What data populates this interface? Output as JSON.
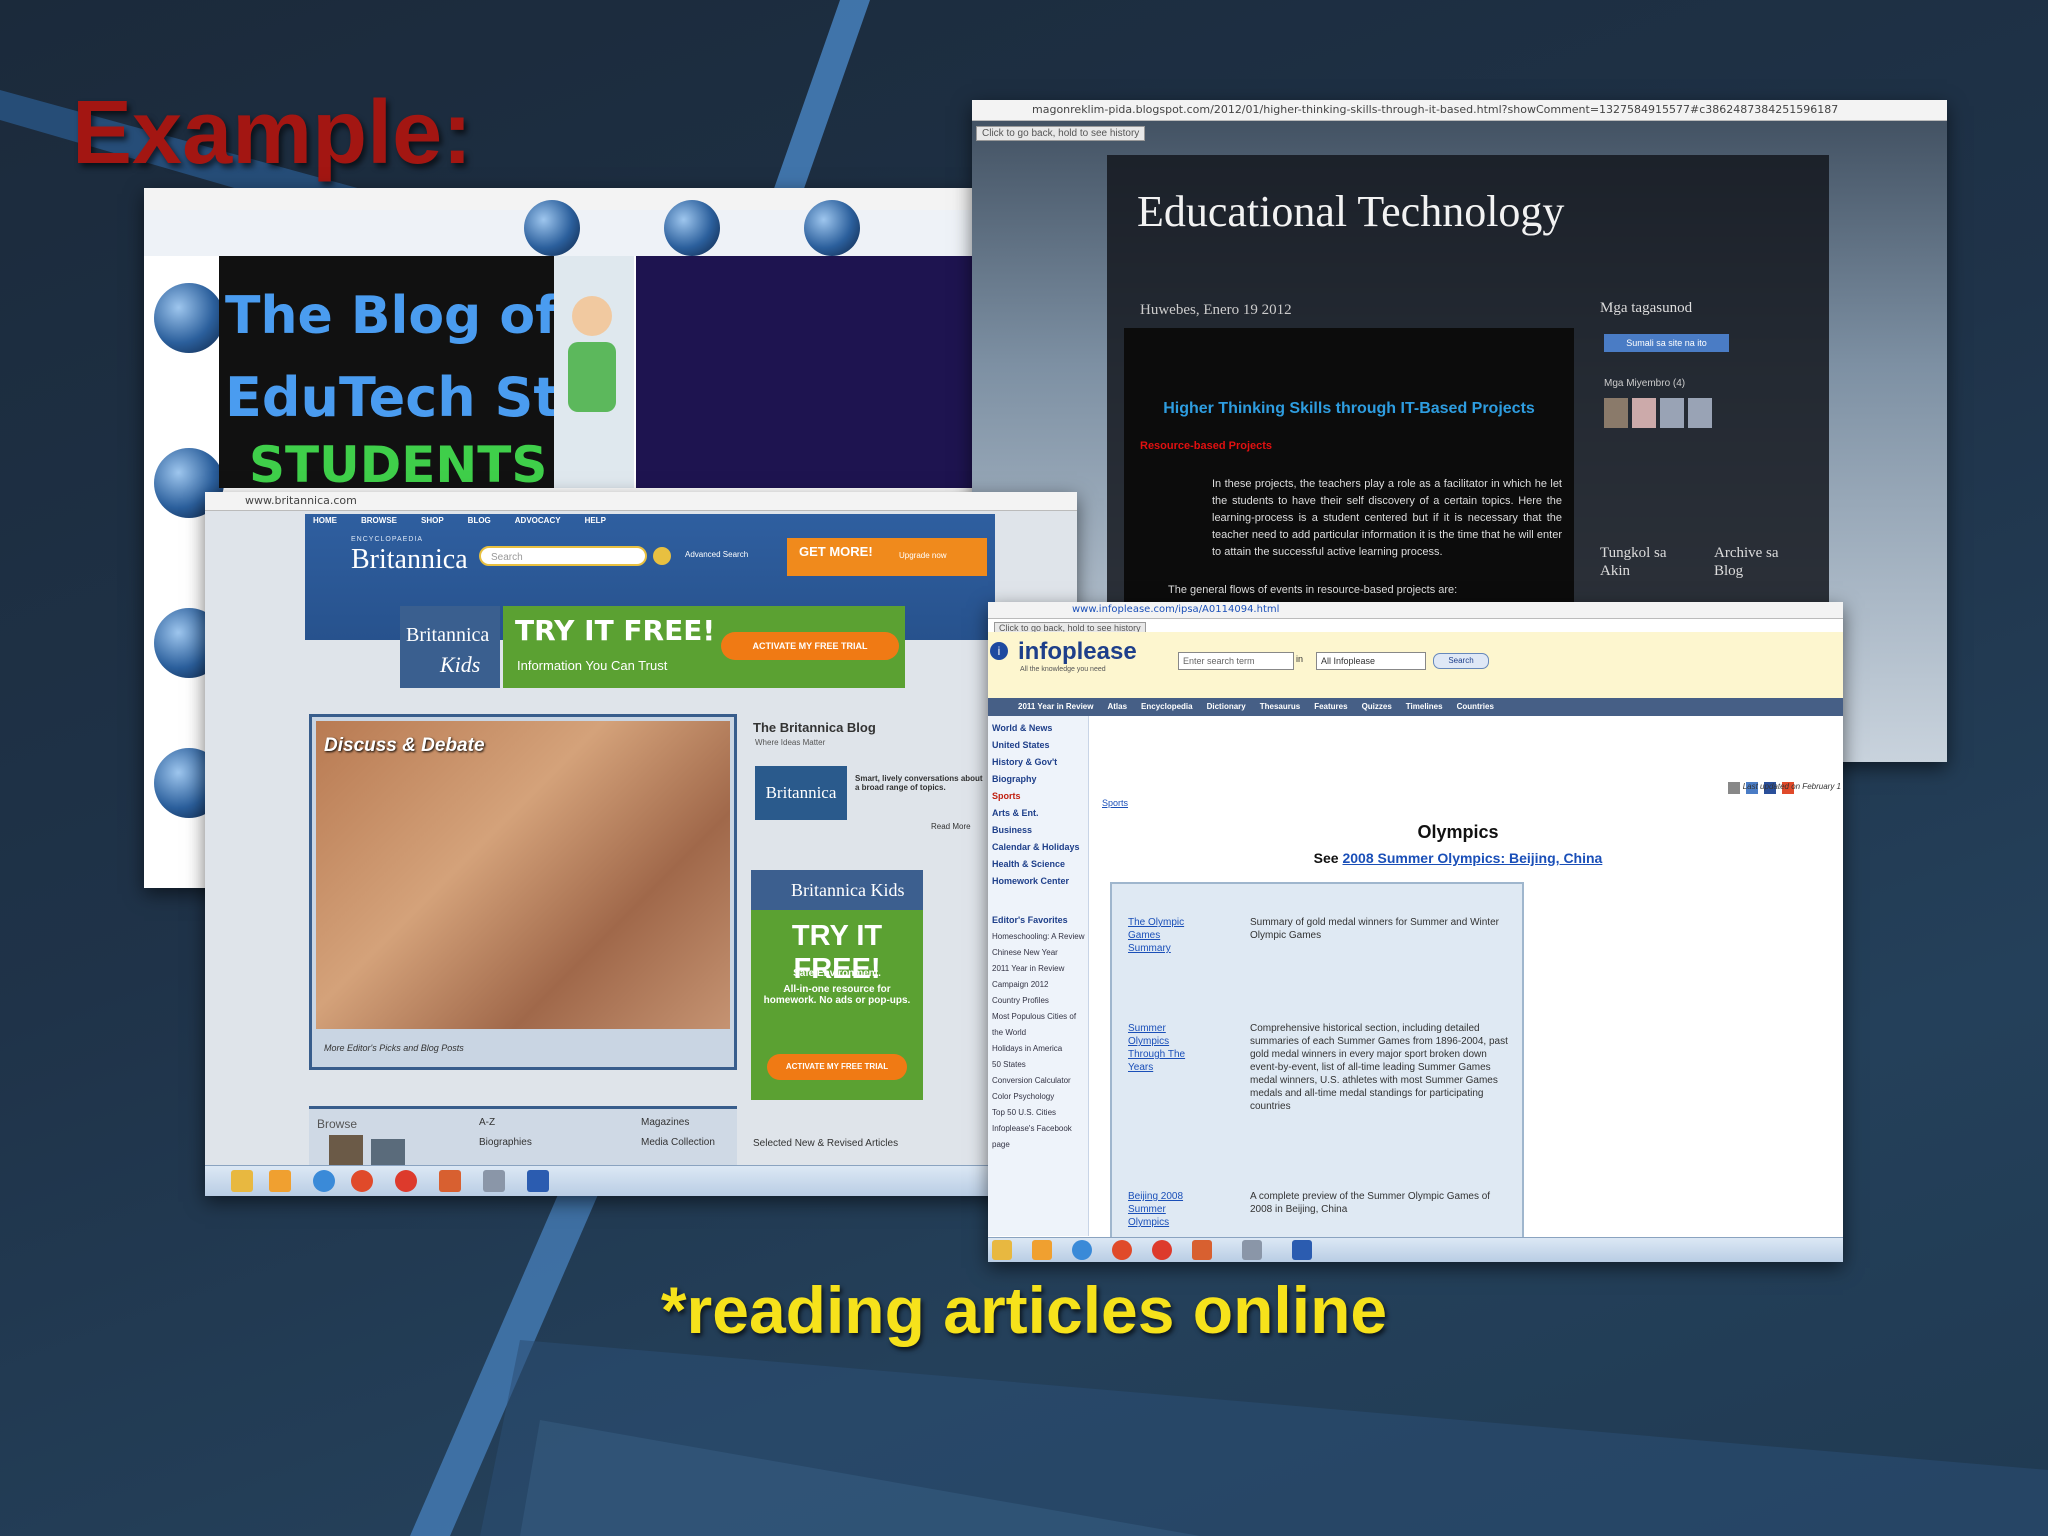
{
  "slide": {
    "title": "Example:",
    "caption": "*reading articles online"
  },
  "colors": {
    "background": "#1f3349",
    "title": "#a31612",
    "caption": "#f6e21b"
  },
  "screenshots": {
    "blog1": {
      "banner_line1": "The Blog of An",
      "banner_line2": "EduTech Student",
      "banner_line3": "STUDENTS"
    },
    "blog2": {
      "url": "magonreklim-pida.blogspot.com/2012/01/higher-thinking-skills-through-it-based.html?showComment=1327584915577#c3862487384251596187",
      "back_tooltip": "Click to go back, hold to see history",
      "blog_title": "Educational Technology",
      "date": "Huwebes, Enero 19 2012",
      "post_title": "Higher Thinking Skills through IT-Based Projects",
      "sub_heading": "Resource-based Projects",
      "paragraph": "In these projects, the teachers play a role as a facilitator in which he let the students to have their self discovery of a certain topics. Here the learning-process is a student centered but if it is necessary that the teacher need to add particular information it is the time that he will enter to attain the successful active learning process.",
      "last_line": "The general flows of events in resource-based projects are:",
      "sidebar_followers": "Mga tagasunod",
      "sidebar_follow_button": "Sumali sa site na ito",
      "sidebar_members": "Mga Miyembro (4)",
      "sidebar_about": "Tungkol sa Akin",
      "sidebar_archive": "Archive sa Blog"
    },
    "britannica": {
      "url": "www.britannica.com",
      "nav": [
        "HOME",
        "BROWSE",
        "SHOP",
        "BLOG",
        "ADVOCACY",
        "HELP"
      ],
      "logo_top": "ENCYCLOPAEDIA",
      "logo": "Britannica",
      "search_placeholder": "Search",
      "advanced_search": "Advanced Search",
      "get_more": "GET MORE!",
      "upgrade": "Upgrade now",
      "kids_logo": "Britannica",
      "kids_sub": "Kids",
      "try_free": "TRY IT FREE!",
      "trust": "Information You Can Trust",
      "activate": "ACTIVATE MY FREE TRIAL",
      "discuss": "Discuss & Debate",
      "more_picks": "More Editor's Picks and Blog Posts",
      "blog_title": "The Britannica Blog",
      "blog_tagline": "Where Ideas Matter",
      "blog_text": "Smart, lively conversations about a broad range of topics.",
      "read_more": "Read More",
      "kids_panel_title": "Britannica Kids",
      "kids_try": "TRY IT FREE!",
      "kids_safe": "Safe Environment.",
      "kids_text": "All-in-one resource for homework. No ads or pop-ups.",
      "kids_activate": "ACTIVATE MY FREE TRIAL",
      "browse": "Browse",
      "browse_links": [
        "A-Z",
        "Biographies",
        "Magazines",
        "Media Collection"
      ],
      "selected": "Selected New & Revised Articles"
    },
    "infoplease": {
      "url": "www.infoplease.com/ipsa/A0114094.html",
      "back_tooltip": "Click to go back, hold to see history",
      "logo": "infoplease",
      "tagline": "All the knowledge you need",
      "search_placeholder": "Enter search term",
      "in_label": "in",
      "scope": "All Infoplease",
      "search_button": "Search",
      "tabs": [
        "2011 Year in Review",
        "Atlas",
        "Encyclopedia",
        "Dictionary",
        "Thesaurus",
        "Features",
        "Quizzes",
        "Timelines",
        "Countries"
      ],
      "left_nav": [
        "World & News",
        "United States",
        "History & Gov't",
        "Biography",
        "Sports",
        "Arts & Ent.",
        "Business",
        "Calendar & Holidays",
        "Health & Science",
        "Homework Center"
      ],
      "favorites_title": "Editor's Favorites",
      "favorites": [
        "Homeschooling: A Review",
        "Chinese New Year",
        "2011 Year in Review",
        "Campaign 2012",
        "Country Profiles",
        "Most Populous Cities of the World",
        "Holidays in America",
        "50 States",
        "Conversion Calculator",
        "Color Psychology",
        "Top 50 U.S. Cities",
        "Infoplease's Facebook page"
      ],
      "last_updated": "Last updated on February 1",
      "breadcrumb": "Sports",
      "heading": "Olympics",
      "see": "See",
      "see_link": "2008 Summer Olympics: Beijing, China",
      "rows": [
        {
          "link": "The Olympic Games Summary",
          "text": "Summary of gold medal winners for Summer and Winter Olympic Games"
        },
        {
          "link": "Summer Olympics Through The Years",
          "text": "Comprehensive historical section, including detailed summaries of each Summer Games from 1896-2004, past gold medal winners in every major sport broken down event-by-event, list of all-time leading Summer Games medal winners, U.S. athletes with most Summer Games medals and all-time medal standings for participating countries"
        },
        {
          "link": "Beijing 2008 Summer Olympics",
          "text": "A complete preview of the Summer Olympic Games of 2008 in Beijing, China"
        }
      ]
    }
  }
}
